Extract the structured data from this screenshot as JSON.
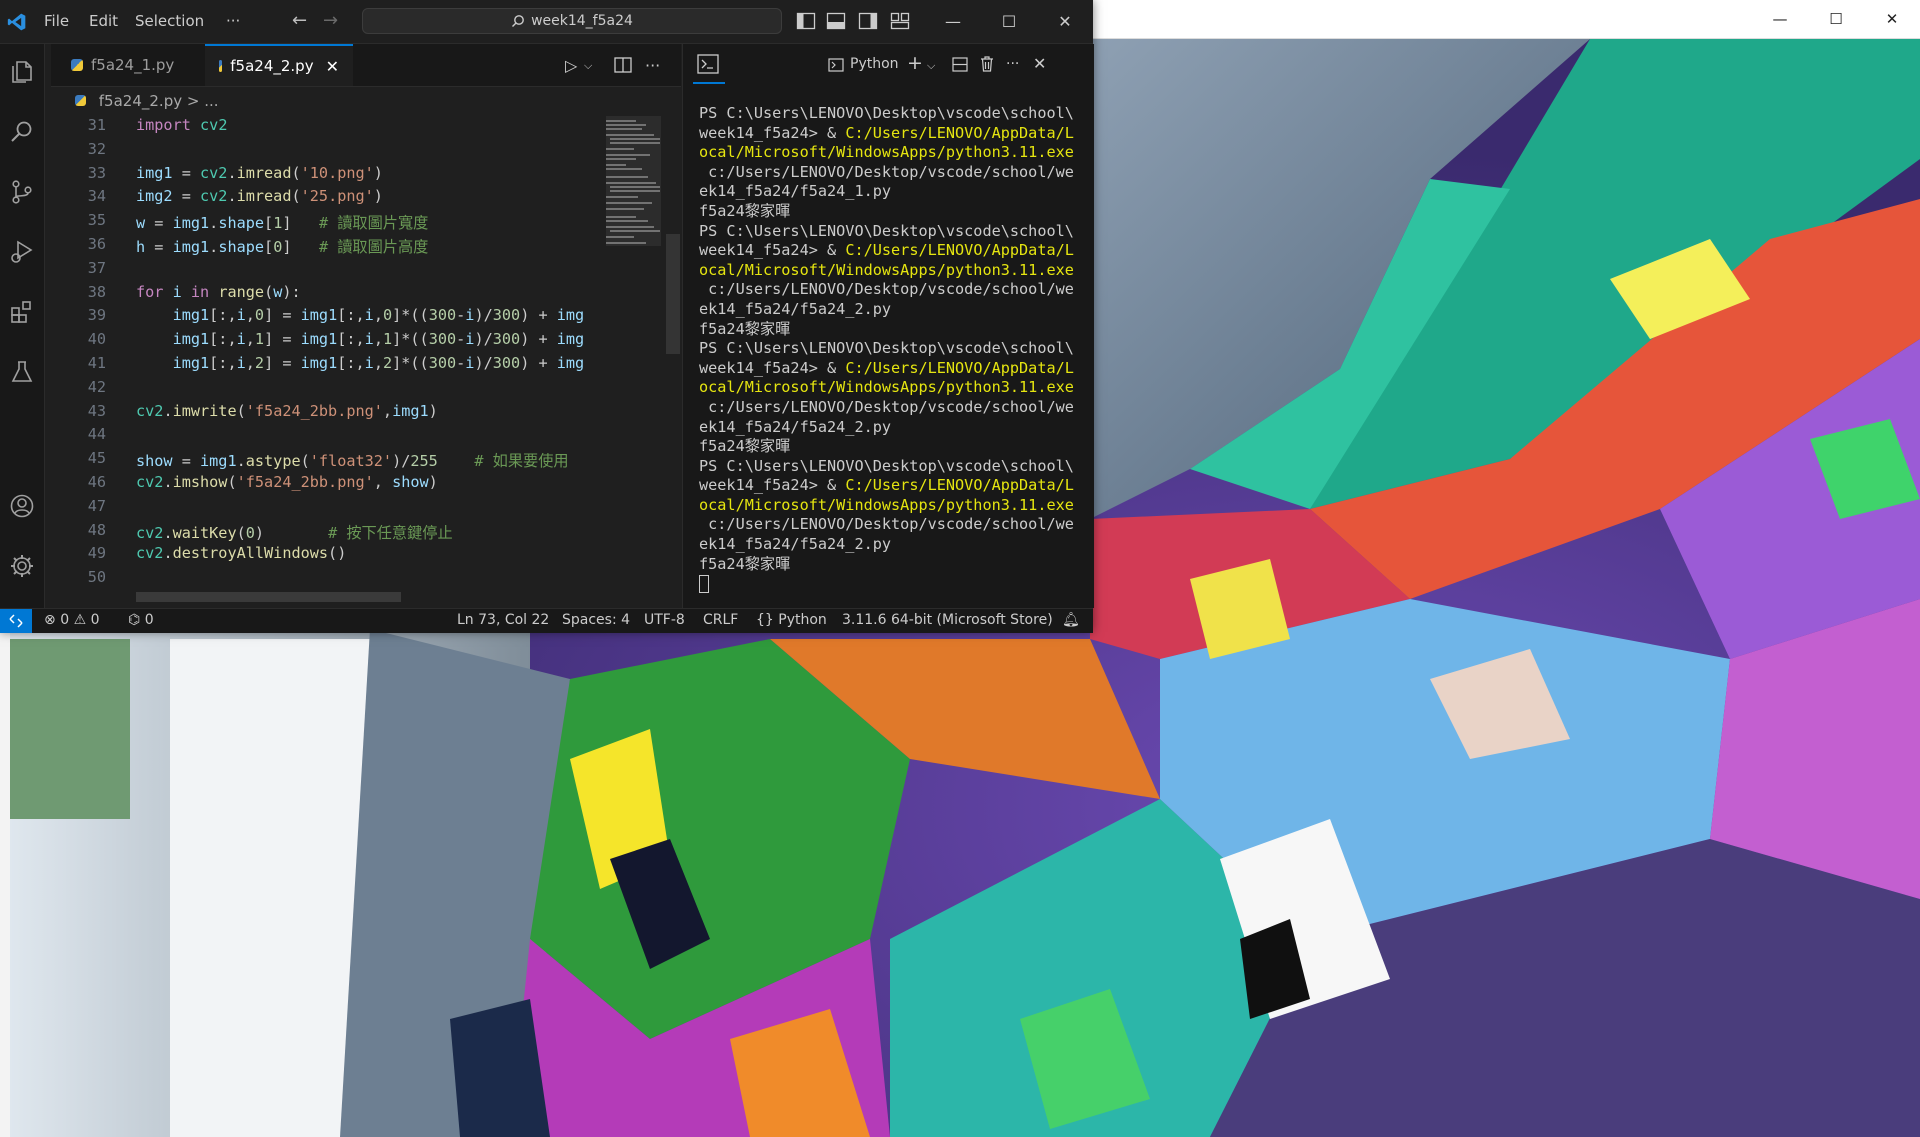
{
  "image_window": {
    "controls": {
      "minimize": "—",
      "maximize": "☐",
      "close": "✕"
    }
  },
  "vscode": {
    "menu": [
      "File",
      "Edit",
      "Selection",
      "···"
    ],
    "search_text": "week14_f5a24",
    "window_controls": {
      "minimize": "—",
      "maximize": "☐",
      "close": "✕"
    },
    "tabs": [
      {
        "label": "f5a24_1.py",
        "active": false
      },
      {
        "label": "f5a24_2.py",
        "active": true
      }
    ],
    "tab_close": "✕",
    "breadcrumb": [
      "f5a24_2.py",
      ">",
      "..."
    ],
    "code_lines": [
      {
        "n": "31",
        "html": "<span class=\"kw\">import</span> <span class=\"teal\">cv2</span>"
      },
      {
        "n": "32",
        "html": ""
      },
      {
        "n": "33",
        "html": "<span class=\"var\">img1</span> = <span class=\"teal\">cv2</span>.<span class=\"fn\">imread</span>(<span class=\"str\">'10.png'</span>)"
      },
      {
        "n": "34",
        "html": "<span class=\"var\">img2</span> = <span class=\"teal\">cv2</span>.<span class=\"fn\">imread</span>(<span class=\"str\">'25.png'</span>)"
      },
      {
        "n": "35",
        "html": "<span class=\"var\">w</span> = <span class=\"var\">img1</span>.<span class=\"var\">shape</span>[<span class=\"num\">1</span>]   <span class=\"cm\"># 讀取圖片寬度</span>"
      },
      {
        "n": "36",
        "html": "<span class=\"var\">h</span> = <span class=\"var\">img1</span>.<span class=\"var\">shape</span>[<span class=\"num\">0</span>]   <span class=\"cm\"># 讀取圖片高度</span>"
      },
      {
        "n": "37",
        "html": ""
      },
      {
        "n": "38",
        "html": "<span class=\"kw\">for</span> <span class=\"var\">i</span> <span class=\"kw\">in</span> <span class=\"fn\">range</span>(<span class=\"var\">w</span>):"
      },
      {
        "n": "39",
        "html": "    <span class=\"var\">img1</span>[:,<span class=\"var\">i</span>,<span class=\"num\">0</span>] = <span class=\"var\">img1</span>[:,<span class=\"var\">i</span>,<span class=\"num\">0</span>]*((<span class=\"num\">300</span>-<span class=\"var\">i</span>)/<span class=\"num\">300</span>) + <span class=\"var\">img</span>"
      },
      {
        "n": "40",
        "html": "    <span class=\"var\">img1</span>[:,<span class=\"var\">i</span>,<span class=\"num\">1</span>] = <span class=\"var\">img1</span>[:,<span class=\"var\">i</span>,<span class=\"num\">1</span>]*((<span class=\"num\">300</span>-<span class=\"var\">i</span>)/<span class=\"num\">300</span>) + <span class=\"var\">img</span>"
      },
      {
        "n": "41",
        "html": "    <span class=\"var\">img1</span>[:,<span class=\"var\">i</span>,<span class=\"num\">2</span>] = <span class=\"var\">img1</span>[:,<span class=\"var\">i</span>,<span class=\"num\">2</span>]*((<span class=\"num\">300</span>-<span class=\"var\">i</span>)/<span class=\"num\">300</span>) + <span class=\"var\">img</span>"
      },
      {
        "n": "42",
        "html": ""
      },
      {
        "n": "43",
        "html": "<span class=\"teal\">cv2</span>.<span class=\"fn\">imwrite</span>(<span class=\"str\">'f5a24_2bb.png'</span>,<span class=\"var\">img1</span>)"
      },
      {
        "n": "44",
        "html": ""
      },
      {
        "n": "45",
        "html": "<span class=\"var\">show</span> = <span class=\"var\">img1</span>.<span class=\"fn\">astype</span>(<span class=\"str\">'float32'</span>)/<span class=\"num\">255</span>    <span class=\"cm\"># 如果要使用</span>"
      },
      {
        "n": "46",
        "html": "<span class=\"teal\">cv2</span>.<span class=\"fn\">imshow</span>(<span class=\"str\">'f5a24_2bb.png'</span>, <span class=\"var\">show</span>)"
      },
      {
        "n": "47",
        "html": ""
      },
      {
        "n": "48",
        "html": "<span class=\"teal\">cv2</span>.<span class=\"fn\">waitKey</span>(<span class=\"num\">0</span>)       <span class=\"cm\"># 按下任意鍵停止</span>"
      },
      {
        "n": "49",
        "html": "<span class=\"teal\">cv2</span>.<span class=\"fn\">destroyAllWindows</span>()"
      },
      {
        "n": "50",
        "html": ""
      }
    ],
    "terminal": {
      "profile": "Python",
      "blocks": [
        {
          "ps": "PS C:\\Users\\LENOVO\\Desktop\\vscode\\school\\\nweek14_f5a24> & ",
          "exe": "C:/Users/LENOVO/AppData/L\nocal/Microsoft/WindowsApps/python3.11.exe",
          "script": "\n c:/Users/LENOVO/Desktop/vscode/school/we\nek14_f5a24/f5a24_1.py\n",
          "out": "f5a24黎家暉"
        },
        {
          "ps": "PS C:\\Users\\LENOVO\\Desktop\\vscode\\school\\\nweek14_f5a24> & ",
          "exe": "C:/Users/LENOVO/AppData/L\nocal/Microsoft/WindowsApps/python3.11.exe",
          "script": "\n c:/Users/LENOVO/Desktop/vscode/school/we\nek14_f5a24/f5a24_2.py\n",
          "out": "f5a24黎家暉"
        },
        {
          "ps": "PS C:\\Users\\LENOVO\\Desktop\\vscode\\school\\\nweek14_f5a24> & ",
          "exe": "C:/Users/LENOVO/AppData/L\nocal/Microsoft/WindowsApps/python3.11.exe",
          "script": "\n c:/Users/LENOVO/Desktop/vscode/school/we\nek14_f5a24/f5a24_2.py\n",
          "out": "f5a24黎家暉"
        },
        {
          "ps": "PS C:\\Users\\LENOVO\\Desktop\\vscode\\school\\\nweek14_f5a24> & ",
          "exe": "C:/Users/LENOVO/AppData/L\nocal/Microsoft/WindowsApps/python3.11.exe",
          "script": "\n c:/Users/LENOVO/Desktop/vscode/school/we\nek14_f5a24/f5a24_2.py\n",
          "out": "f5a24黎家暉"
        }
      ]
    },
    "status": {
      "errors": "0",
      "warnings": "0",
      "ports": "0",
      "position": "Ln 73, Col 22",
      "spaces": "Spaces: 4",
      "encoding": "UTF-8",
      "eol": "CRLF",
      "language": "Python",
      "interpreter": "3.11.6 64-bit (Microsoft Store)"
    }
  },
  "colors": {
    "accent": "#0078d4",
    "editor_bg": "#1f1f1f",
    "terminal_yellow": "#e5e510"
  }
}
